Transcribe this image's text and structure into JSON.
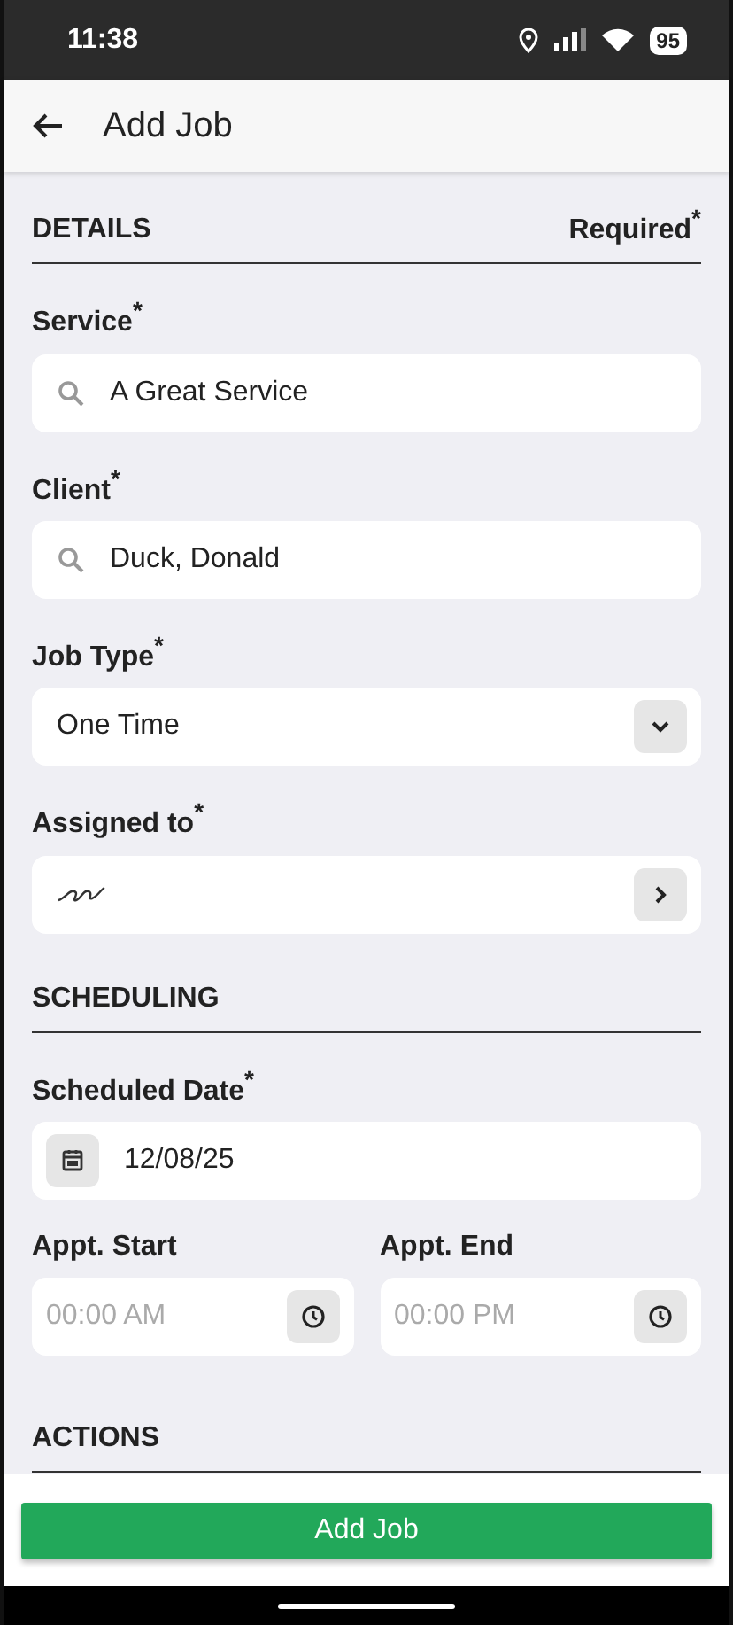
{
  "status_bar": {
    "time": "11:38",
    "battery": "95"
  },
  "header": {
    "title": "Add Job"
  },
  "details": {
    "title": "DETAILS",
    "required_note": "Required$^{*}$",
    "fields": [
      {
        "kind": "search",
        "label": "Service$^{*}$",
        "value": "A Great Service"
      },
      {
        "kind": "search",
        "label": "Client$^{*}$",
        "value": "Duck, Donald"
      },
      {
        "kind": "select",
        "label": "Job Type$^{*}$",
        "value": "One Time"
      },
      {
        "kind": "signature",
        "label": "Assigned to$^{*}$"
      }
    ]
  },
  "scheduling": {
    "title": "SCHEDULING",
    "date": {
      "label": "Scheduled Date$^{*}$",
      "value": "12/08/25"
    },
    "times": [
      {
        "label": "Appt. Start",
        "placeholder": "00:00 AM"
      },
      {
        "label": "Appt. End",
        "placeholder": "00:00 PM"
      }
    ]
  },
  "actions": {
    "title": "ACTIONS"
  },
  "submit": {
    "label": "Add Job"
  }
}
